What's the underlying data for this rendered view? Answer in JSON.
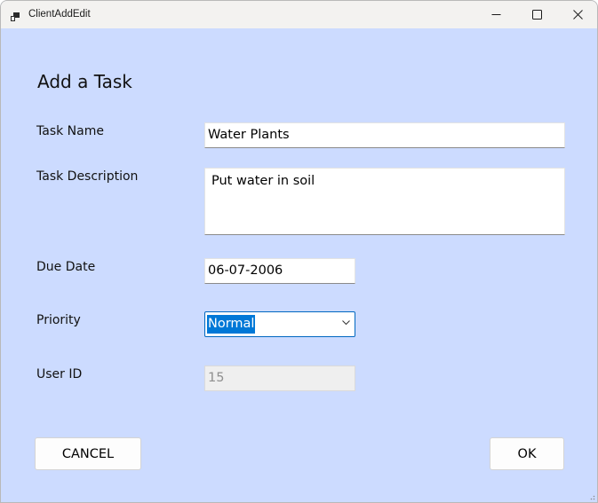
{
  "window": {
    "title": "ClientAddEdit",
    "icon": "app-window-icon"
  },
  "form": {
    "heading": "Add a Task",
    "task_name": {
      "label": "Task Name",
      "value": "Water Plants"
    },
    "task_description": {
      "label": "Task Description",
      "value": "Put water in soil"
    },
    "due_date": {
      "label": "Due Date",
      "value": "06-07-2006"
    },
    "priority": {
      "label": "Priority",
      "value": "Normal"
    },
    "user_id": {
      "label": "User ID",
      "value": "15"
    }
  },
  "buttons": {
    "cancel": "CANCEL",
    "ok": "OK"
  },
  "colors": {
    "background": "#ccdbff",
    "titlebar": "#f3f2f0",
    "selection": "#0078d7",
    "focus_border": "#0067c0"
  }
}
